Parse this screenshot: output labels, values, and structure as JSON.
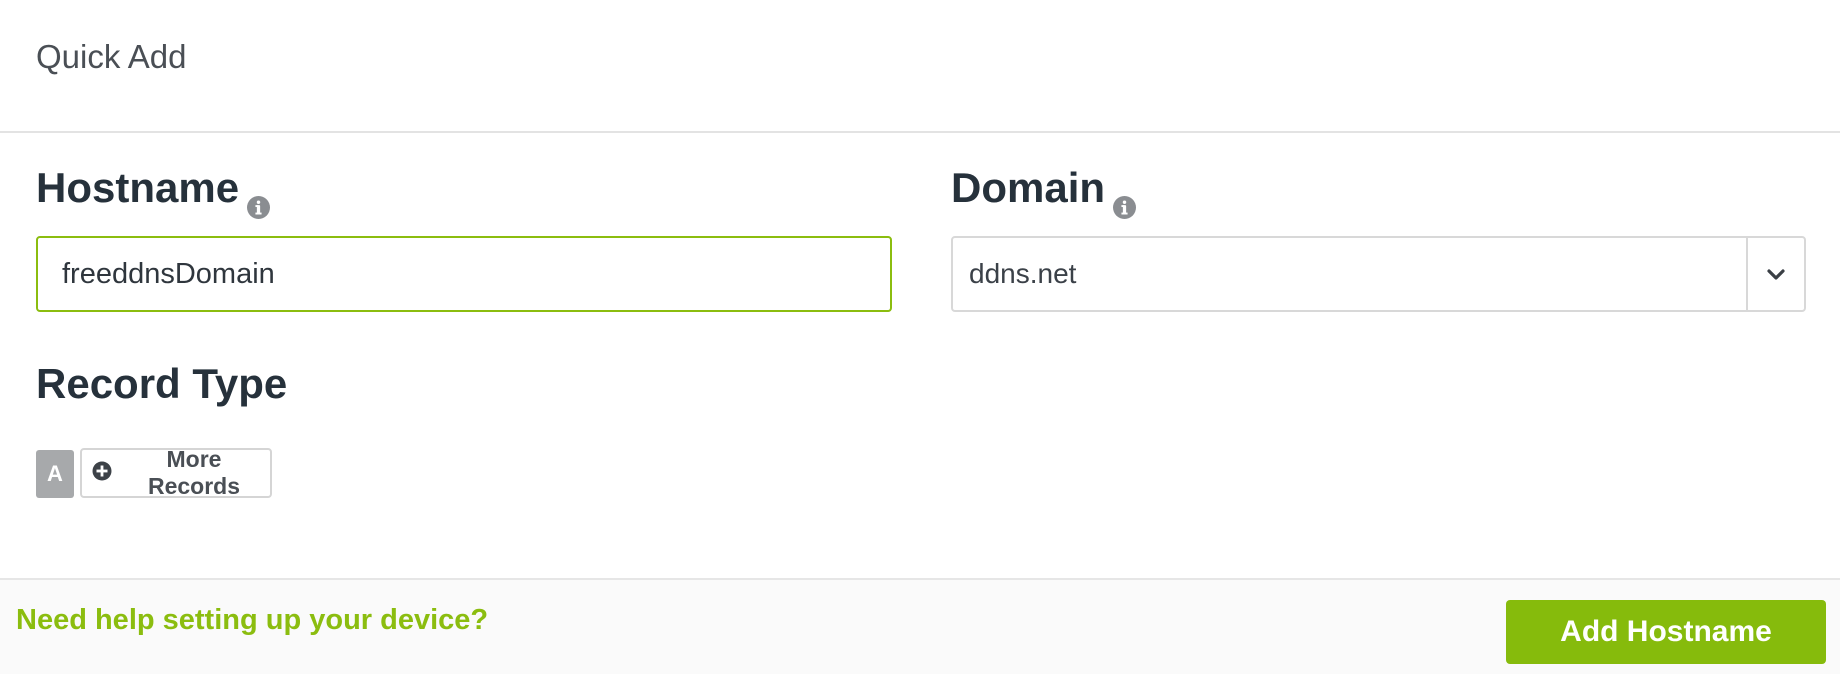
{
  "header": {
    "title": "Quick Add"
  },
  "form": {
    "hostname": {
      "label": "Hostname",
      "value": "freeddnsDomain",
      "icon": "info-icon"
    },
    "domain": {
      "label": "Domain",
      "selected": "ddns.net",
      "icon": "info-icon",
      "caret_icon": "chevron-down-icon"
    },
    "record_type": {
      "label": "Record Type",
      "selected": "A",
      "more_label": "More Records",
      "more_icon": "plus-circle-icon"
    }
  },
  "footer": {
    "help_link": "Need help setting up your device?",
    "submit_label": "Add Hostname"
  },
  "colors": {
    "accent": "#8bbd0f",
    "button": "#86bb0c",
    "heading": "#26313b",
    "badge_gray": "#a7a9ab"
  }
}
